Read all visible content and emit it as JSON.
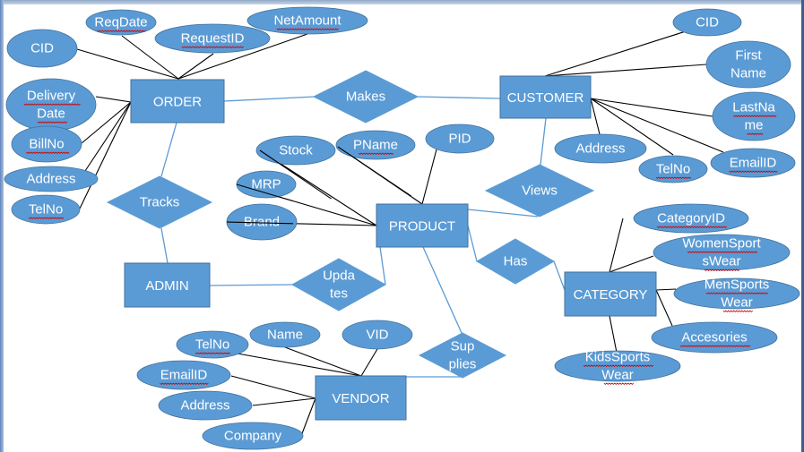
{
  "diagram": {
    "type": "ER diagram",
    "colors": {
      "shape_fill": "#5b9bd5",
      "shape_stroke": "#41719c",
      "attribute_link": "#000000",
      "relationship_link": "#5b9bd5",
      "text": "#ffffff",
      "spellcheck_underline": "#d00000"
    },
    "entities": [
      {
        "id": "order",
        "label": "ORDER"
      },
      {
        "id": "customer",
        "label": "CUSTOMER"
      },
      {
        "id": "product",
        "label": "PRODUCT"
      },
      {
        "id": "admin",
        "label": "ADMIN"
      },
      {
        "id": "category",
        "label": "CATEGORY"
      },
      {
        "id": "vendor",
        "label": "VENDOR"
      }
    ],
    "relationships": [
      {
        "id": "makes",
        "lines": [
          "Makes"
        ],
        "connects": [
          "order",
          "customer"
        ]
      },
      {
        "id": "tracks",
        "lines": [
          "Tracks"
        ],
        "connects": [
          "order",
          "admin"
        ]
      },
      {
        "id": "views",
        "lines": [
          "Views"
        ],
        "connects": [
          "customer",
          "product"
        ]
      },
      {
        "id": "has",
        "lines": [
          "Has"
        ],
        "connects": [
          "product",
          "category"
        ]
      },
      {
        "id": "updates",
        "lines": [
          "Upda",
          "tes"
        ],
        "connects": [
          "admin",
          "product"
        ]
      },
      {
        "id": "supplies",
        "lines": [
          "Sup",
          "plies"
        ],
        "connects": [
          "product",
          "vendor"
        ]
      }
    ],
    "attributes": [
      {
        "entity": "order",
        "lines": [
          "CID"
        ],
        "flagged": false
      },
      {
        "entity": "order",
        "lines": [
          "ReqDate"
        ],
        "flagged": true
      },
      {
        "entity": "order",
        "lines": [
          "RequestID"
        ],
        "flagged": true
      },
      {
        "entity": "order",
        "lines": [
          "NetAmount"
        ],
        "flagged": true
      },
      {
        "entity": "order",
        "lines": [
          "Delivery",
          "Date"
        ],
        "flagged": true
      },
      {
        "entity": "order",
        "lines": [
          "BillNo"
        ],
        "flagged": true
      },
      {
        "entity": "order",
        "lines": [
          "Address"
        ],
        "flagged": false
      },
      {
        "entity": "order",
        "lines": [
          "TelNo"
        ],
        "flagged": true
      },
      {
        "entity": "customer",
        "lines": [
          "CID"
        ],
        "flagged": false
      },
      {
        "entity": "customer",
        "lines": [
          "First",
          "Name"
        ],
        "flagged": false
      },
      {
        "entity": "customer",
        "lines": [
          "LastNa",
          "me"
        ],
        "flagged": true
      },
      {
        "entity": "customer",
        "lines": [
          "Address"
        ],
        "flagged": false
      },
      {
        "entity": "customer",
        "lines": [
          "TelNo"
        ],
        "flagged": true
      },
      {
        "entity": "customer",
        "lines": [
          "EmailID"
        ],
        "flagged": true
      },
      {
        "entity": "product",
        "lines": [
          "Stock"
        ],
        "flagged": false
      },
      {
        "entity": "product",
        "lines": [
          "PName"
        ],
        "flagged": true
      },
      {
        "entity": "product",
        "lines": [
          "PID"
        ],
        "flagged": false
      },
      {
        "entity": "product",
        "lines": [
          "MRP"
        ],
        "flagged": false
      },
      {
        "entity": "product",
        "lines": [
          "Brand"
        ],
        "flagged": false
      },
      {
        "entity": "category",
        "lines": [
          "CategoryID"
        ],
        "flagged": true
      },
      {
        "entity": "category",
        "lines": [
          "WomenSport",
          "sWear"
        ],
        "flagged": true
      },
      {
        "entity": "category",
        "lines": [
          "MenSports",
          "Wear"
        ],
        "flagged": true
      },
      {
        "entity": "category",
        "lines": [
          "Accesories"
        ],
        "flagged": true
      },
      {
        "entity": "category",
        "lines": [
          "KidsSports",
          "Wear"
        ],
        "flagged": true
      },
      {
        "entity": "vendor",
        "lines": [
          "TelNo"
        ],
        "flagged": true
      },
      {
        "entity": "vendor",
        "lines": [
          "Name"
        ],
        "flagged": false
      },
      {
        "entity": "vendor",
        "lines": [
          "VID"
        ],
        "flagged": false
      },
      {
        "entity": "vendor",
        "lines": [
          "EmailID"
        ],
        "flagged": true
      },
      {
        "entity": "vendor",
        "lines": [
          "Address"
        ],
        "flagged": false
      },
      {
        "entity": "vendor",
        "lines": [
          "Company"
        ],
        "flagged": false
      }
    ]
  }
}
